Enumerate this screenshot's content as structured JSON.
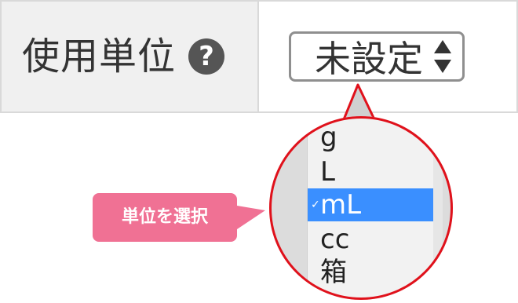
{
  "field": {
    "label": "使用単位",
    "help_icon_glyph": "?"
  },
  "select": {
    "value": "未設定"
  },
  "dropdown": {
    "options": [
      "g",
      "L",
      "mL",
      "cc",
      "箱"
    ],
    "selected": "mL",
    "selected_color": "#3a8fff"
  },
  "annotation": {
    "label": "単位を選択",
    "tag_color": "#f07194",
    "ring_color": "#e0111b"
  }
}
